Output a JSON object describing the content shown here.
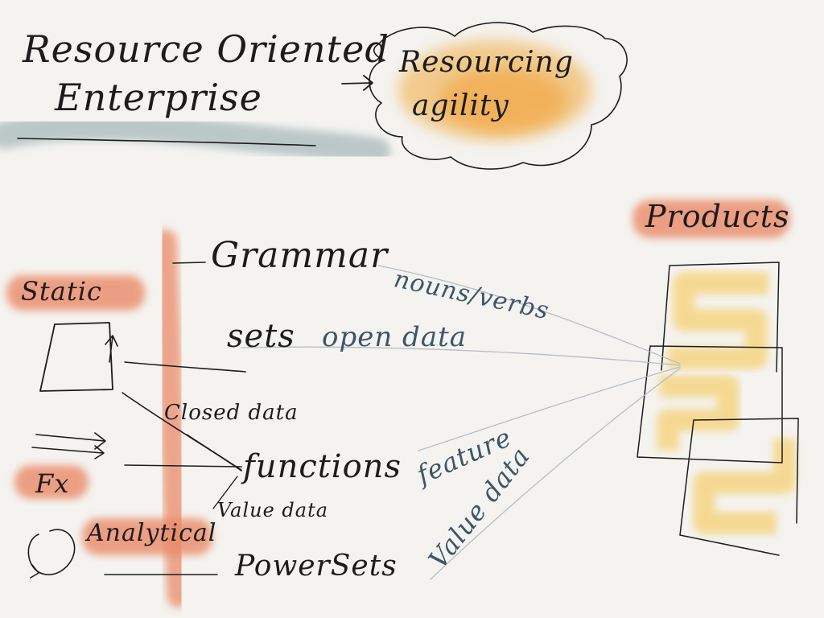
{
  "title": {
    "line1": "Resource Oriented",
    "line2": "Enterprise"
  },
  "goal": {
    "line1": "Resourcing",
    "line2": "agility"
  },
  "products": {
    "label": "Products"
  },
  "left": {
    "static_label": "Static",
    "fx_label": "Fx",
    "analytical_label": "Analytical"
  },
  "middle": {
    "grammar": "Grammar",
    "sets": "sets",
    "functions": "functions",
    "powersets": "PowerSets",
    "closed_data": "Closed data",
    "value_data_small": "Value data"
  },
  "flows": {
    "nouns_verbs": "nouns/verbs",
    "open_data": "open data",
    "feature": "feature",
    "value_data": "Value data"
  },
  "colors": {
    "ink": "#1c1c1c",
    "blue_ink": "#3e5468",
    "orange_wash": "#ea8a68",
    "yellow_wash": "#f6cf6c",
    "amber_wash": "#f0a93a",
    "slate_wash": "#8da5a8"
  }
}
